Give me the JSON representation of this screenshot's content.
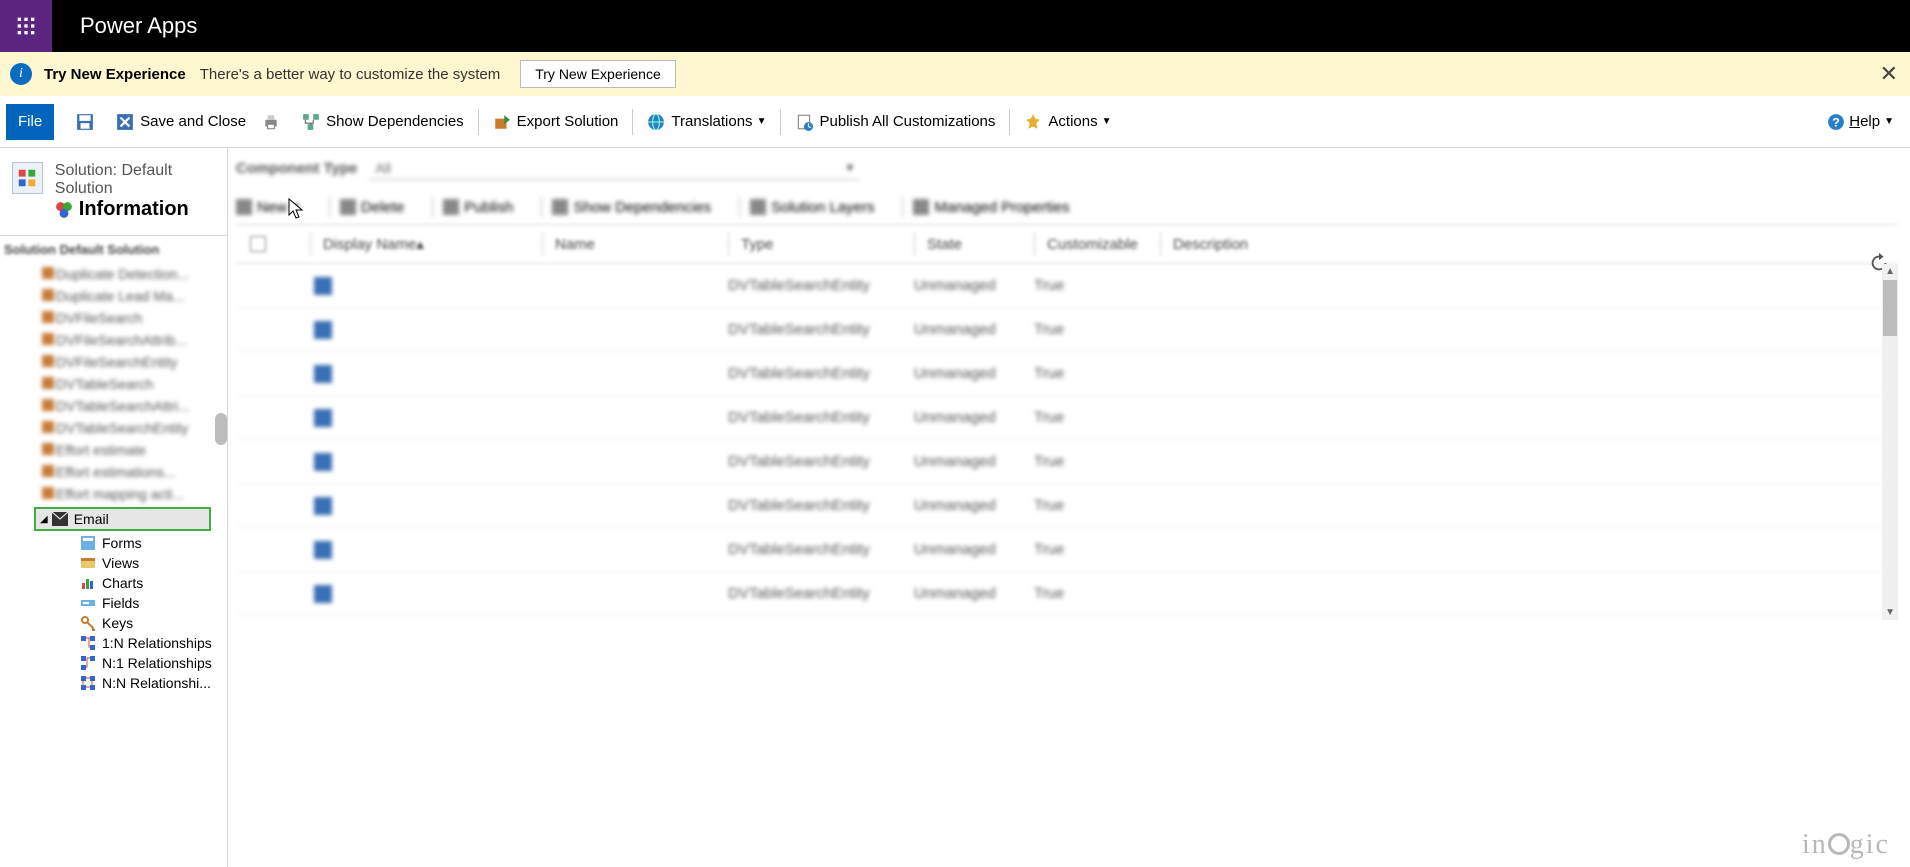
{
  "app": {
    "title": "Power Apps"
  },
  "banner": {
    "heading": "Try New Experience",
    "message": "There's a better way to customize the system",
    "button": "Try New Experience"
  },
  "commands": {
    "file": "File",
    "save": "",
    "saveClose": "Save and Close",
    "showDeps": "Show Dependencies",
    "export": "Export Solution",
    "translations": "Translations",
    "publishAll": "Publish All Customizations",
    "actions": "Actions",
    "help": "Help"
  },
  "solution": {
    "breadcrumb": "Solution: Default Solution",
    "title": "Information",
    "treeHead": "Solution Default Solution"
  },
  "tree": {
    "blur": [
      "Duplicate Detection...",
      "Duplicate Lead Ma...",
      "DVFileSearch",
      "DVFileSearchAttrib...",
      "DVFileSearchEntity",
      "DVTableSearch",
      "DVTableSearchAttri...",
      "DVTableSearchEntity",
      "Effort estimate",
      "Effort estimations...",
      "Effort mapping acti..."
    ],
    "selected": "Email",
    "children": [
      {
        "icon": "form",
        "label": "Forms"
      },
      {
        "icon": "view",
        "label": "Views"
      },
      {
        "icon": "chart",
        "label": "Charts"
      },
      {
        "icon": "field",
        "label": "Fields"
      },
      {
        "icon": "key",
        "label": "Keys"
      },
      {
        "icon": "1n",
        "label": "1:N Relationships"
      },
      {
        "icon": "n1",
        "label": "N:1 Relationships"
      },
      {
        "icon": "nn",
        "label": "N:N Relationshi..."
      }
    ]
  },
  "content": {
    "filterLabel": "Component Type",
    "filterValue": "All",
    "subcommands": [
      "New",
      "Delete",
      "Publish",
      "Show Dependencies",
      "Solution Layers",
      "Managed Properties"
    ],
    "columns": [
      "Display Name",
      "Name",
      "Type",
      "State",
      "Customizable",
      "Description"
    ],
    "rows": [
      {
        "type": "DVTableSearchEntity",
        "state": "Unmanaged",
        "cust": "True"
      },
      {
        "type": "DVTableSearchEntity",
        "state": "Unmanaged",
        "cust": "True"
      },
      {
        "type": "DVTableSearchEntity",
        "state": "Unmanaged",
        "cust": "True"
      },
      {
        "type": "DVTableSearchEntity",
        "state": "Unmanaged",
        "cust": "True"
      },
      {
        "type": "DVTableSearchEntity",
        "state": "Unmanaged",
        "cust": "True"
      },
      {
        "type": "DVTableSearchEntity",
        "state": "Unmanaged",
        "cust": "True"
      },
      {
        "type": "DVTableSearchEntity",
        "state": "Unmanaged",
        "cust": "True"
      },
      {
        "type": "DVTableSearchEntity",
        "state": "Unmanaged",
        "cust": "True"
      }
    ]
  },
  "watermark": "inogic"
}
